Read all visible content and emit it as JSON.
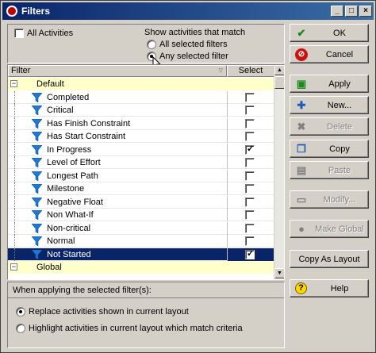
{
  "window": {
    "title": "Filters"
  },
  "top": {
    "all_activities_label": "All Activities",
    "show_match_label": "Show activities that match",
    "radio_all": "All selected filters",
    "radio_any": "Any selected filter"
  },
  "grid": {
    "col_filter": "Filter",
    "col_select": "Select",
    "group_default": "Default",
    "group_global": "Global",
    "items": [
      {
        "name": "Completed",
        "checked": false
      },
      {
        "name": "Critical",
        "checked": false
      },
      {
        "name": "Has Finish Constraint",
        "checked": false
      },
      {
        "name": "Has Start Constraint",
        "checked": false
      },
      {
        "name": "In Progress",
        "checked": true
      },
      {
        "name": "Level of Effort",
        "checked": false
      },
      {
        "name": "Longest Path",
        "checked": false
      },
      {
        "name": "Milestone",
        "checked": false
      },
      {
        "name": "Negative Float",
        "checked": false
      },
      {
        "name": "Non What-If",
        "checked": false
      },
      {
        "name": "Non-critical",
        "checked": false
      },
      {
        "name": "Normal",
        "checked": false
      },
      {
        "name": "Not Started",
        "checked": true
      }
    ]
  },
  "bottom": {
    "header": "When applying the selected filter(s):",
    "radio_replace": "Replace activities shown in current layout",
    "radio_highlight": "Highlight activities in current layout which match criteria"
  },
  "buttons": {
    "ok": "OK",
    "cancel": "Cancel",
    "apply": "Apply",
    "new": "New...",
    "delete": "Delete",
    "copy": "Copy",
    "paste": "Paste",
    "modify": "Modify...",
    "make_global": "Make Global",
    "copy_as_layout": "Copy As Layout",
    "help": "Help"
  },
  "colors": {
    "title_bar": "#0a246a",
    "selection": "#0a246a",
    "group_row": "#ffffcc",
    "funnel": "#1e7ad6"
  }
}
